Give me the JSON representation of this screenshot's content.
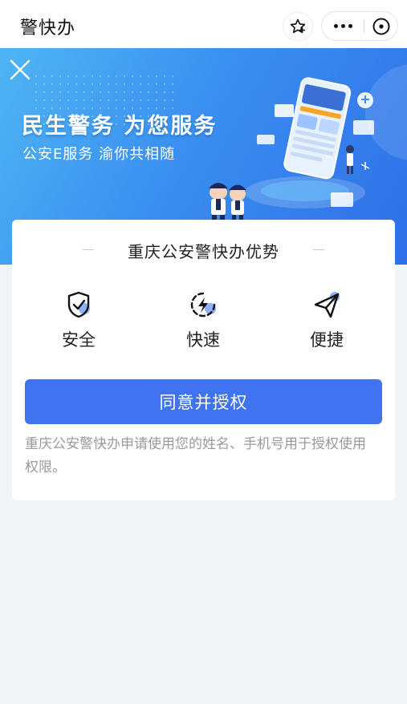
{
  "window": {
    "title": "警快办"
  },
  "banner": {
    "headline": "民生警务 为您服务",
    "subline": "公安E服务 渝你共相随"
  },
  "card": {
    "title": "重庆公安警快办优势",
    "features": [
      {
        "label": "安全",
        "icon": "shield-check-icon"
      },
      {
        "label": "快速",
        "icon": "lightning-speed-icon"
      },
      {
        "label": "便捷",
        "icon": "paper-plane-icon"
      }
    ],
    "agree_button": "同意并授权",
    "notice": "重庆公安警快办申请使用您的姓名、手机号用于授权使用权限。"
  },
  "colors": {
    "accent": "#4073f0",
    "banner_start": "#4fb6f4",
    "banner_end": "#2f6fe8",
    "icon_blue": "#8fb0f5"
  }
}
